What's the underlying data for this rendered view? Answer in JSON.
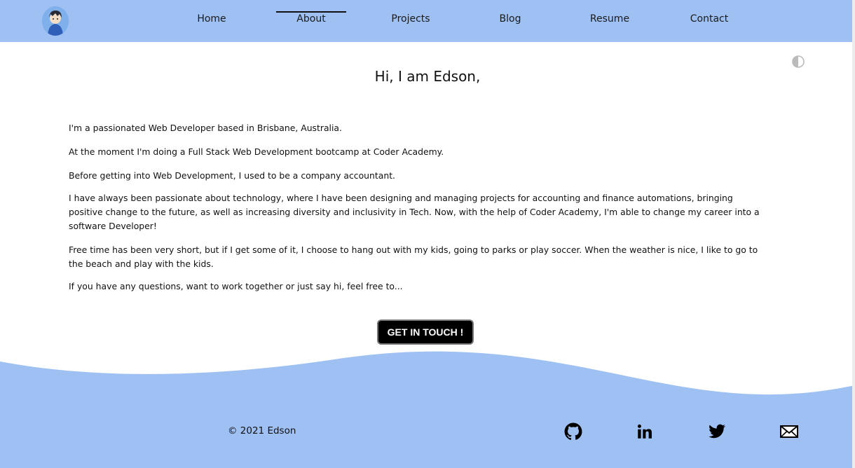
{
  "nav": {
    "logo_alt": "avatar",
    "links": [
      {
        "label": "Home",
        "active": false
      },
      {
        "label": "About",
        "active": true
      },
      {
        "label": "Projects",
        "active": false
      },
      {
        "label": "Blog",
        "active": false
      },
      {
        "label": "Resume",
        "active": false
      },
      {
        "label": "Contact",
        "active": false
      }
    ]
  },
  "theme_toggle": {
    "icon": "half-circle-icon"
  },
  "about": {
    "greeting": "Hi, I am Edson,",
    "paragraphs": [
      "I'm a passionated Web Developer based in Brisbane, Australia.",
      "At the moment I'm doing a Full Stack Web Development bootcamp at Coder Academy.",
      "Before getting into Web Development, I used to be a company accountant.",
      "I have always been passionate about technology, where I have been designing and managing projects for accounting and finance automations, bringing positive change to the future, as well as increasing diversity and inclusivity in Tech. Now, with the help of Coder Academy, I'm able to change my career into a software Developer!",
      "Free time has been very short, but if I get some of it, I choose to hang out with my kids, going to parks or play soccer. When the weather is nice, I like to go to the beach and play with the kids.",
      "If you have any questions, want to work together or just say hi, feel free to..."
    ],
    "cta_label": "GET IN TOUCH !"
  },
  "footer": {
    "copyright": "© 2021 Edson",
    "social": [
      {
        "icon": "github-icon"
      },
      {
        "icon": "linkedin-icon"
      },
      {
        "icon": "twitter-icon"
      },
      {
        "icon": "email-icon"
      }
    ]
  },
  "colors": {
    "accent": "#9ec0f3",
    "button_bg": "#000000",
    "text": "#111111"
  }
}
